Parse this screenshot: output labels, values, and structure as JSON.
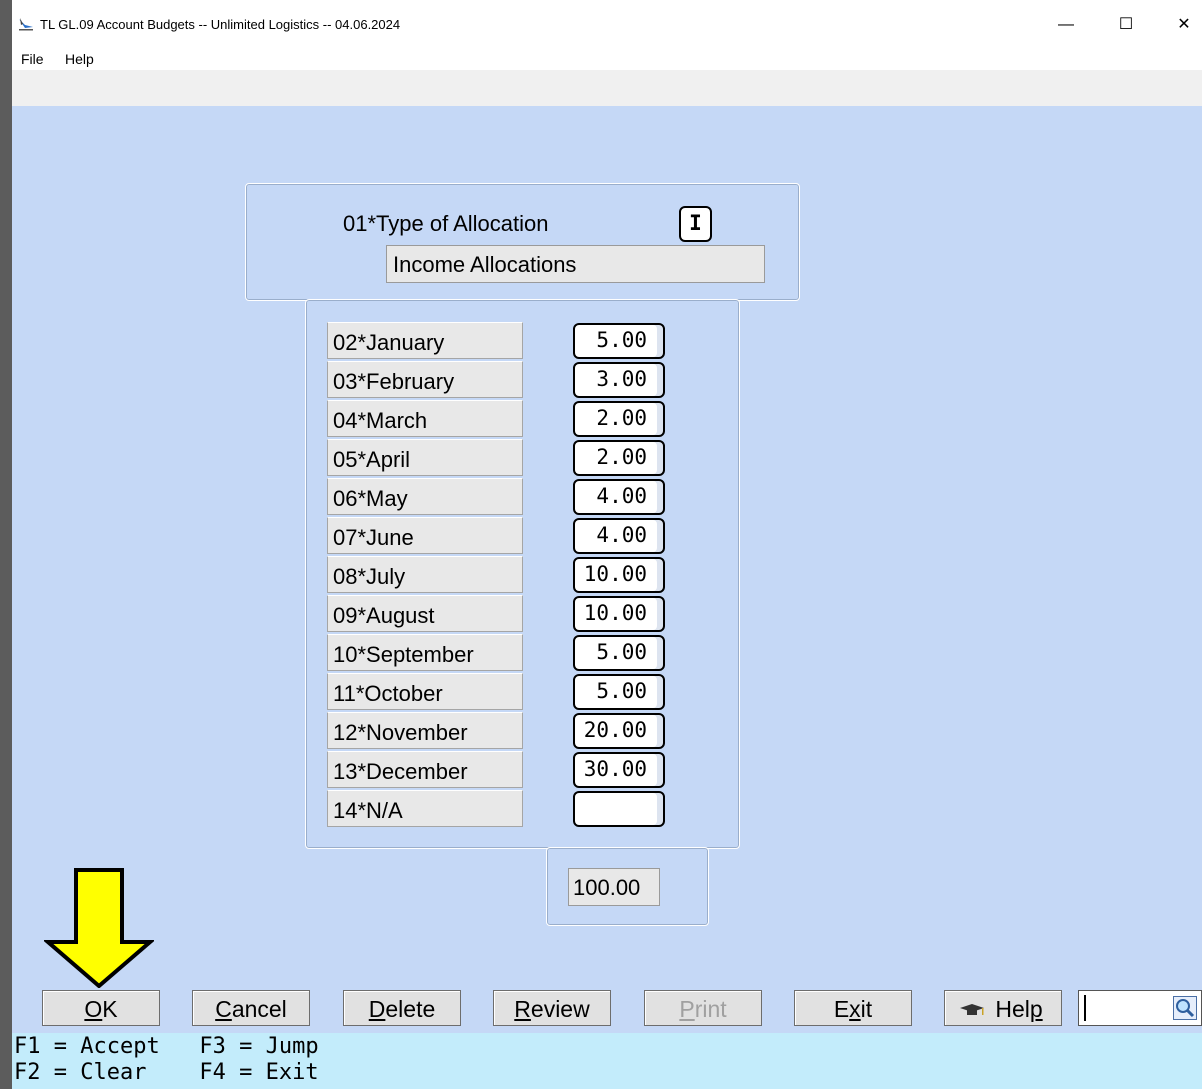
{
  "window": {
    "title": "TL GL.09 Account Budgets -- Unlimited Logistics -- 04.06.2024",
    "controls": {
      "minimize": "—",
      "maximize": "☐",
      "close": "✕"
    }
  },
  "menu": {
    "items": [
      "File",
      "Help"
    ]
  },
  "allocation": {
    "label": "01*Type of Allocation",
    "code": "I",
    "description": "Income Allocations"
  },
  "months": [
    {
      "label": "02*January",
      "value": "5.00"
    },
    {
      "label": "03*February",
      "value": "3.00"
    },
    {
      "label": "04*March",
      "value": "2.00"
    },
    {
      "label": "05*April",
      "value": "2.00"
    },
    {
      "label": "06*May",
      "value": "4.00"
    },
    {
      "label": "07*June",
      "value": "4.00"
    },
    {
      "label": "08*July",
      "value": "10.00"
    },
    {
      "label": "09*August",
      "value": "10.00"
    },
    {
      "label": "10*September",
      "value": "5.00"
    },
    {
      "label": "11*October",
      "value": "5.00"
    },
    {
      "label": "12*November",
      "value": "20.00"
    },
    {
      "label": "13*December",
      "value": "30.00"
    },
    {
      "label": "14*N/A",
      "value": ""
    }
  ],
  "total": "100.00",
  "buttons": {
    "ok": {
      "hot": "O",
      "rest": "K"
    },
    "cancel": {
      "hot": "C",
      "rest": "ancel"
    },
    "delete": {
      "hot": "D",
      "rest": "elete"
    },
    "review": {
      "hot": "R",
      "rest": "eview"
    },
    "print": {
      "hot": "P",
      "rest": "rint"
    },
    "exit": {
      "pre": "E",
      "hot": "x",
      "rest": "it"
    },
    "help": {
      "pre": "Hel",
      "hot": "p",
      "rest": ""
    }
  },
  "status": {
    "line1": "F1 = Accept   F3 = Jump",
    "line2": "F2 = Clear    F4 = Exit"
  },
  "colors": {
    "background": "#c5d8f6",
    "status_bar": "#c3ecfb",
    "arrow_fill": "#ffff00"
  },
  "icons": {
    "app": "bird-logo-icon",
    "help_button": "mortarboard-icon",
    "search": "magnifier-icon",
    "annotation": "arrow-down-icon"
  }
}
